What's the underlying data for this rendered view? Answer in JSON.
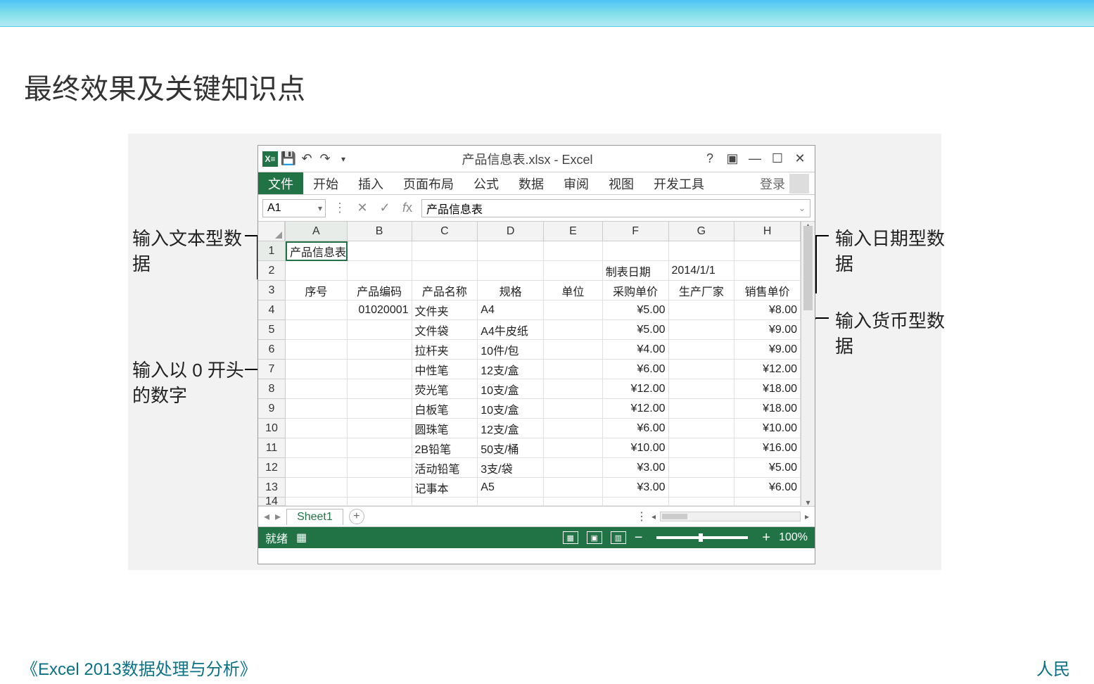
{
  "slide": {
    "title": "最终效果及关键知识点",
    "footer_left": "《Excel 2013数据处理与分析》",
    "footer_right": "人民"
  },
  "annotations": {
    "text_data": "输入文本型数据",
    "zero_prefix": "输入以 0 开头的数字",
    "date_data": "输入日期型数据",
    "currency_data": "输入货币型数据"
  },
  "excel": {
    "title": "产品信息表.xlsx - Excel",
    "tabs": {
      "file": "文件",
      "home": "开始",
      "insert": "插入",
      "layout": "页面布局",
      "formula": "公式",
      "data": "数据",
      "review": "审阅",
      "view": "视图",
      "dev": "开发工具"
    },
    "signin": "登录",
    "namebox": "A1",
    "formula_value": "产品信息表",
    "col_headers": [
      "A",
      "B",
      "C",
      "D",
      "E",
      "F",
      "G",
      "H"
    ],
    "row_headers": [
      "1",
      "2",
      "3",
      "4",
      "5",
      "6",
      "7",
      "8",
      "9",
      "10",
      "11",
      "12",
      "13",
      "14"
    ],
    "cells": {
      "A1": "产品信息表",
      "F2": "制表日期",
      "G2": "2014/1/1",
      "A3": "序号",
      "B3": "产品编码",
      "C3": "产品名称",
      "D3": "规格",
      "E3": "单位",
      "F3": "采购单价",
      "G3": "生产厂家",
      "H3": "销售单价",
      "B4": "01020001",
      "C4": "文件夹",
      "D4": "A4",
      "F4": "¥5.00",
      "H4": "¥8.00",
      "C5": "文件袋",
      "D5": "A4牛皮纸",
      "F5": "¥5.00",
      "H5": "¥9.00",
      "C6": "拉杆夹",
      "D6": "10件/包",
      "F6": "¥4.00",
      "H6": "¥9.00",
      "C7": "中性笔",
      "D7": "12支/盒",
      "F7": "¥6.00",
      "H7": "¥12.00",
      "C8": "荧光笔",
      "D8": "10支/盒",
      "F8": "¥12.00",
      "H8": "¥18.00",
      "C9": "白板笔",
      "D9": "10支/盒",
      "F9": "¥12.00",
      "H9": "¥18.00",
      "C10": "圆珠笔",
      "D10": "12支/盒",
      "F10": "¥6.00",
      "H10": "¥10.00",
      "C11": "2B铅笔",
      "D11": "50支/桶",
      "F11": "¥10.00",
      "H11": "¥16.00",
      "C12": "活动铅笔",
      "D12": "3支/袋",
      "F12": "¥3.00",
      "H12": "¥5.00",
      "C13": "记事本",
      "D13": "A5",
      "F13": "¥3.00",
      "H13": "¥6.00"
    },
    "sheet_tab": "Sheet1",
    "status_ready": "就绪",
    "zoom": "100%"
  }
}
